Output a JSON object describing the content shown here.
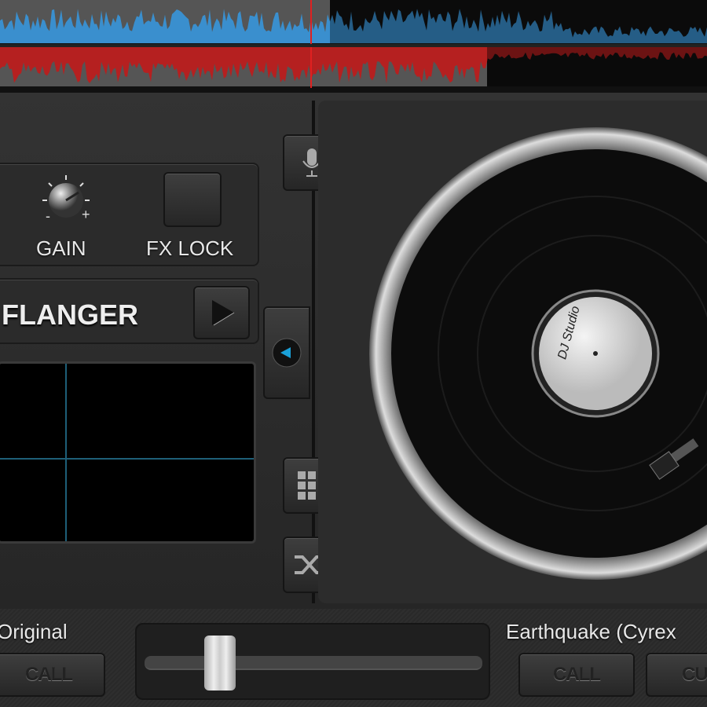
{
  "colors": {
    "blue": "#3a8fce",
    "red": "#b52020",
    "accent": "#1aa0d8"
  },
  "fx_controls": {
    "gain_label": "GAIN",
    "fx_lock_label": "FX LOCK",
    "gain_minus": "-",
    "gain_plus": "+"
  },
  "effect": {
    "name": "FLANGER"
  },
  "deck_left": {
    "track_title": "Original",
    "call_label": "CALL"
  },
  "deck_right": {
    "track_title": "Earthquake (Cyrex",
    "call_label": "CALL",
    "cue_label": "CU"
  },
  "crossfader": {
    "position": 0.13
  },
  "record_label": {
    "logo_text": "DJ Studio"
  }
}
